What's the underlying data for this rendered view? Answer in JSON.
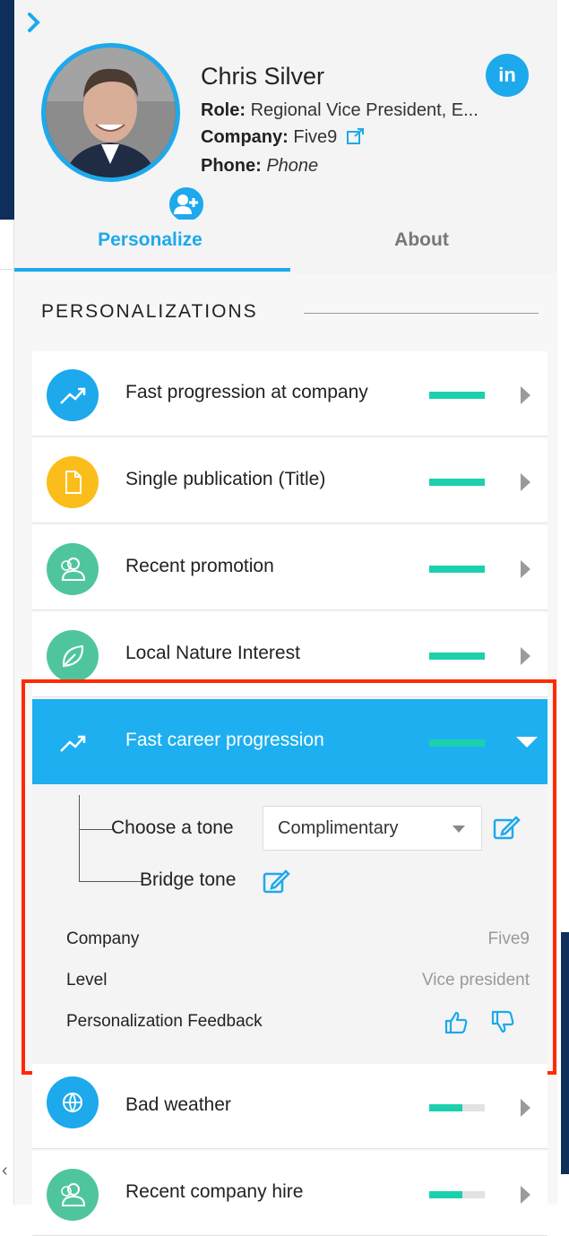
{
  "profile": {
    "name": "Chris Silver",
    "role_label": "Role:",
    "role_value": "Regional Vice President, E...",
    "company_label": "Company:",
    "company_value": "Five9",
    "phone_label": "Phone:",
    "phone_value": "Phone",
    "linkedin_text": "in"
  },
  "tabs": [
    {
      "label": "Personalize",
      "active": true
    },
    {
      "label": "About",
      "active": false
    }
  ],
  "section_title": "PERSONALIZATIONS",
  "items": [
    {
      "label": "Fast progression at company",
      "icon": "trending-up-icon",
      "icon_color": "#1da9ec",
      "strength": 1.0
    },
    {
      "label": "Single publication (Title)",
      "icon": "document-icon",
      "icon_color": "#fbbd1a",
      "strength": 1.0
    },
    {
      "label": "Recent promotion",
      "icon": "people-icon",
      "icon_color": "#4fc59e",
      "strength": 1.0
    },
    {
      "label": "Local Nature Interest",
      "icon": "leaf-icon",
      "icon_color": "#4fc59e",
      "strength": 1.0
    }
  ],
  "expanded": {
    "label": "Fast career progression",
    "icon": "trending-up-icon",
    "strength": 1.0,
    "tone_label": "Choose a tone",
    "tone_value": "Complimentary",
    "bridge_label": "Bridge tone",
    "details": [
      {
        "key": "Company",
        "value": "Five9"
      },
      {
        "key": "Level",
        "value": "Vice president"
      },
      {
        "key": "Personalization Feedback",
        "value": ""
      }
    ]
  },
  "items_after": [
    {
      "label": "Bad weather",
      "icon": "globe-icon",
      "icon_color": "#1da9ec",
      "strength": 0.6
    },
    {
      "label": "Recent company hire",
      "icon": "people-icon",
      "icon_color": "#4fc59e",
      "strength": 0.6
    }
  ],
  "colors": {
    "accent": "#1da9ec",
    "strength": "#1cd0ad",
    "highlight": "#ff2a00"
  }
}
